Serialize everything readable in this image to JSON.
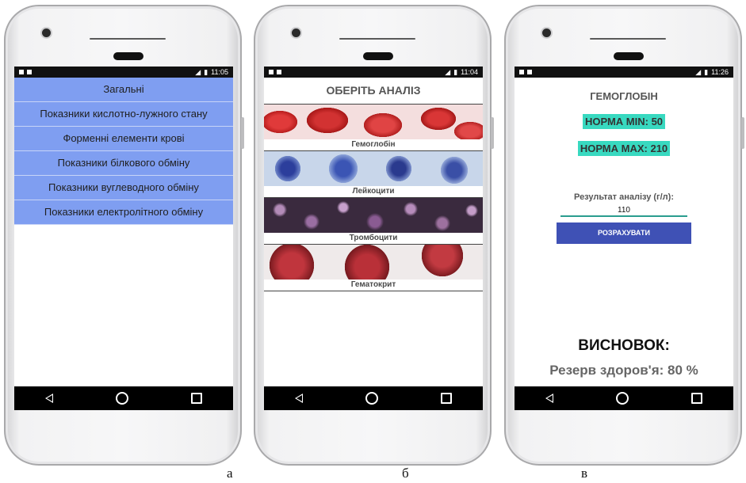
{
  "status": {
    "a_time": "11:05",
    "b_time": "11:04",
    "c_time": "11:26"
  },
  "screen_a": {
    "menu": [
      "Загальні",
      "Показники кислотно-лужного стану",
      "Форменні елементи крові",
      "Показники білкового обміну",
      "Показники вуглеводного обміну",
      "Показники електролітного обміну"
    ]
  },
  "screen_b": {
    "title": "ОБЕРІТЬ АНАЛІЗ",
    "tiles": [
      "Гемоглобін",
      "Лейкоцити",
      "Тромбоцити",
      "Гематокрит"
    ]
  },
  "screen_c": {
    "title": "ГЕМОГЛОБІН",
    "norm_min": "НОРМА MIN: 50",
    "norm_max": "НОРМА MAX: 210",
    "norm_color": "#38d9c0",
    "input_label": "Результат аналізу (г/л):",
    "input_value": "110",
    "button_label": "РОЗРАХУВАТИ",
    "button_color": "#3f51b5",
    "conclusion_heading": "ВИСНОВОК:",
    "conclusion_text": "Резерв здоров'я: 80 %"
  },
  "captions": [
    "а",
    "б",
    "в"
  ]
}
